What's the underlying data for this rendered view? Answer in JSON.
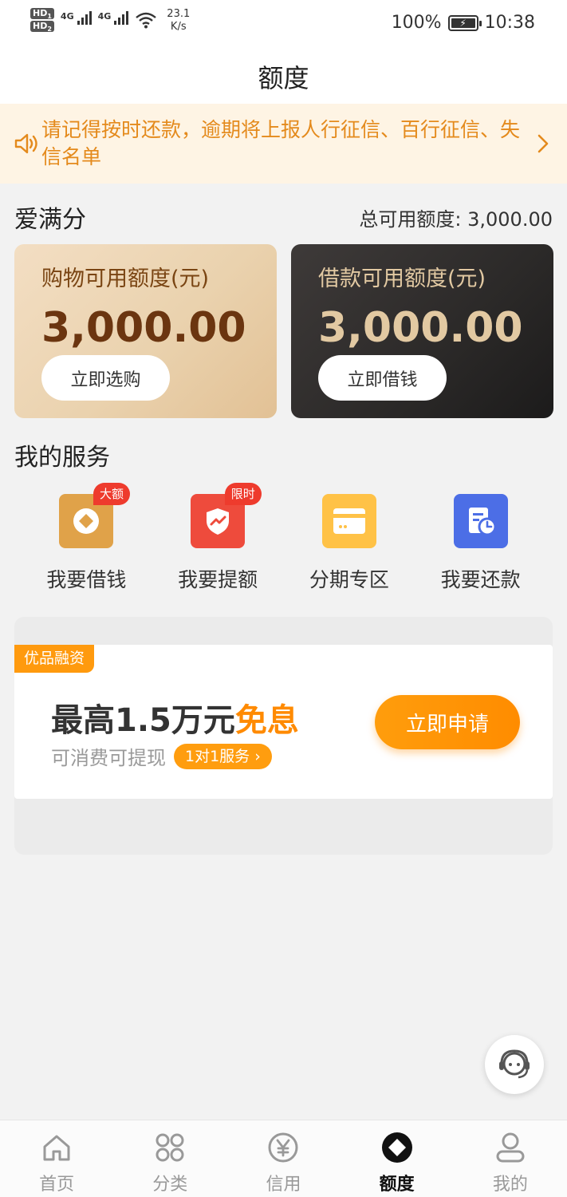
{
  "status_bar": {
    "hd1": "HD",
    "hd1_sub": "1",
    "hd2": "HD",
    "hd2_sub": "2",
    "net1": "4G",
    "net2": "4G",
    "speed_value": "23.1",
    "speed_unit": "K/s",
    "battery": "100%",
    "time": "10:38"
  },
  "header": {
    "title": "额度"
  },
  "notice": {
    "text": "请记得按时还款，逾期将上报人行征信、百行征信、失信名单"
  },
  "score": {
    "title": "爱满分",
    "total_limit": "总可用额度: 3,000.00"
  },
  "cards": {
    "shopping": {
      "label": "购物可用额度(元)",
      "amount": "3,000.00",
      "button": "立即选购"
    },
    "loan": {
      "label": "借款可用额度(元)",
      "amount": "3,000.00",
      "button": "立即借钱"
    }
  },
  "services": {
    "title": "我的服务",
    "items": [
      {
        "label": "我要借钱",
        "badge": "大额",
        "icon": "coin-diamond-icon",
        "color": "#e0a249"
      },
      {
        "label": "我要提额",
        "badge": "限时",
        "icon": "shield-trend-icon",
        "color": "#ee4b3c"
      },
      {
        "label": "分期专区",
        "badge": "",
        "icon": "card-icon",
        "color": "#ffc247"
      },
      {
        "label": "我要还款",
        "badge": "",
        "icon": "bill-clock-icon",
        "color": "#4c6ee6"
      }
    ]
  },
  "promo": {
    "tag": "优品融资",
    "headline_main": "最高1.5万元",
    "headline_highlight": "免息",
    "subtext": "可消费可提现",
    "pill": "1对1服务 ›",
    "button": "立即申请"
  },
  "tabbar": {
    "items": [
      {
        "label": "首页",
        "icon": "home-icon"
      },
      {
        "label": "分类",
        "icon": "grid-icon"
      },
      {
        "label": "信用",
        "icon": "yen-circle-icon"
      },
      {
        "label": "额度",
        "icon": "diamond-circle-icon",
        "active": true
      },
      {
        "label": "我的",
        "icon": "profile-icon"
      }
    ]
  },
  "colors": {
    "accent": "#ff9a0e",
    "notice_text": "#e48a1c",
    "notice_bg": "#fef4e4"
  }
}
